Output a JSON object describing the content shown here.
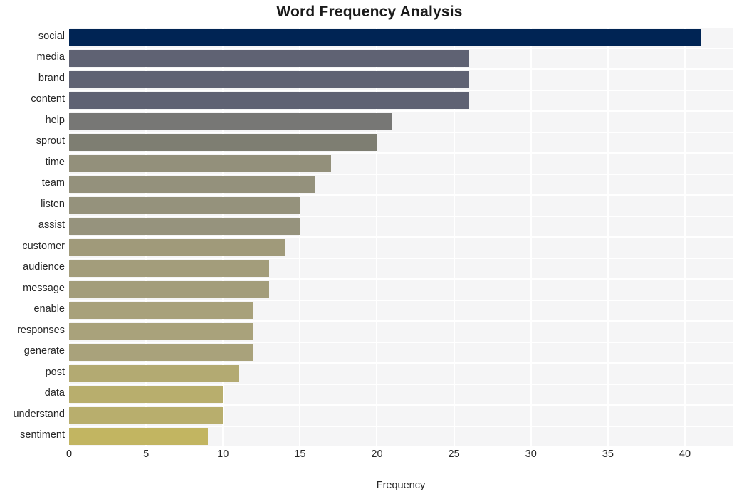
{
  "chart_data": {
    "type": "bar",
    "orientation": "horizontal",
    "title": "Word Frequency Analysis",
    "xlabel": "Frequency",
    "ylabel": "",
    "categories": [
      "social",
      "media",
      "brand",
      "content",
      "help",
      "sprout",
      "time",
      "team",
      "listen",
      "assist",
      "customer",
      "audience",
      "message",
      "enable",
      "responses",
      "generate",
      "post",
      "data",
      "understand",
      "sentiment"
    ],
    "values": [
      41,
      26,
      26,
      26,
      21,
      20,
      17,
      16,
      15,
      15,
      14,
      13,
      13,
      12,
      12,
      12,
      11,
      10,
      10,
      9
    ],
    "bar_colors": [
      "#002454",
      "#5f6273",
      "#5f6273",
      "#5f6273",
      "#777775",
      "#7e7e72",
      "#93907b",
      "#94917c",
      "#95927c",
      "#96937d",
      "#a09a7a",
      "#a39d7b",
      "#a39d7b",
      "#a8a17b",
      "#a9a27b",
      "#a9a27b",
      "#b3aa72",
      "#b8ae6d",
      "#b8ae6d",
      "#c2b561"
    ],
    "xlim": [
      0,
      43.1
    ],
    "xticks": [
      0,
      5,
      10,
      15,
      20,
      25,
      30,
      35,
      40
    ],
    "xticklabels": [
      "0",
      "5",
      "10",
      "15",
      "20",
      "25",
      "30",
      "35",
      "40"
    ],
    "grid": true,
    "grid_color": "#ffffff",
    "plot_background": "#f5f5f6",
    "figure_background": "#ffffff",
    "legend": null
  }
}
